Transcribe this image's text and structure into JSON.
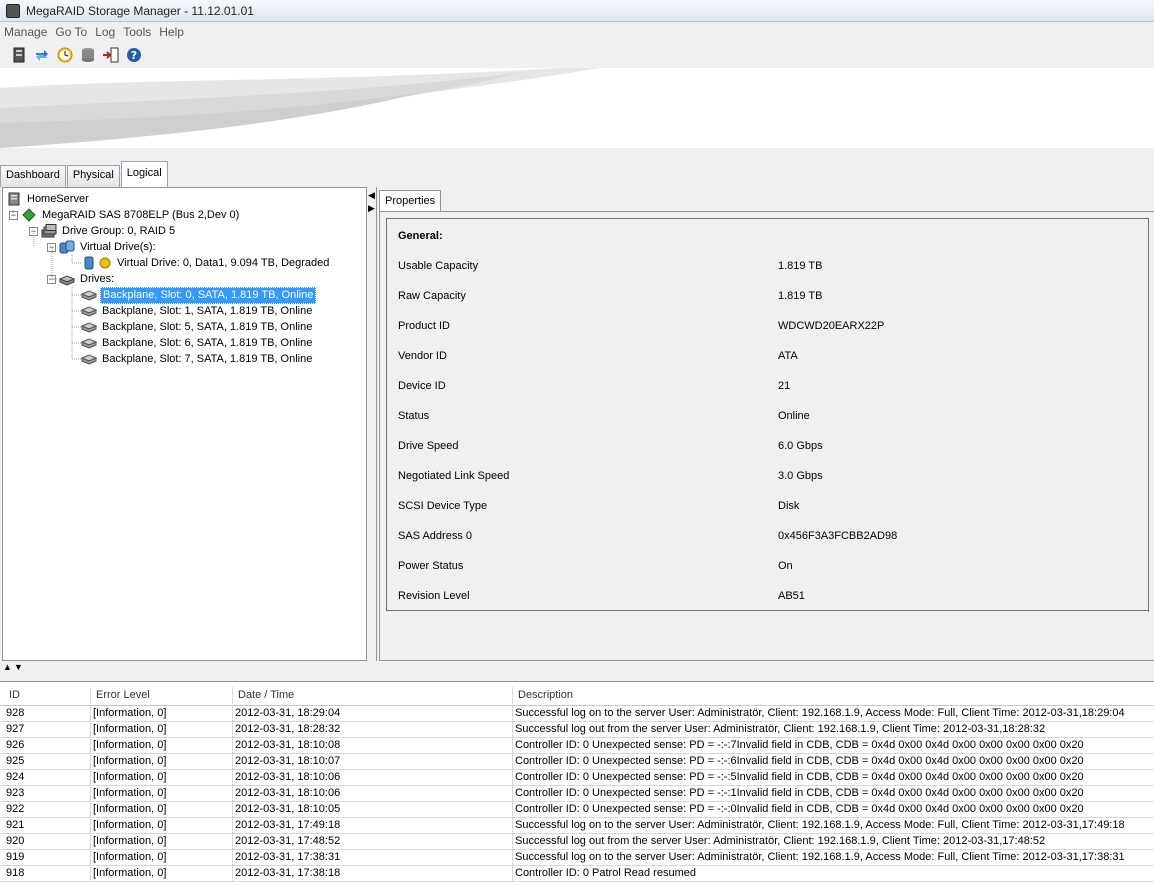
{
  "window": {
    "title": "MegaRAID Storage Manager - 11.12.01.01"
  },
  "menu": [
    "Manage",
    "Go To",
    "Log",
    "Tools",
    "Help"
  ],
  "toolbar": {
    "icons": [
      "server-icon",
      "refresh-icon",
      "clock-icon",
      "database-icon",
      "exit-icon",
      "help-icon"
    ]
  },
  "tabs": {
    "dashboard": "Dashboard",
    "physical": "Physical",
    "logical": "Logical"
  },
  "tree": {
    "root": "HomeServer",
    "controller": "MegaRAID SAS 8708ELP (Bus 2,Dev 0)",
    "drive_group": "Drive Group: 0, RAID  5",
    "virtual_drives_label": "Virtual Drive(s):",
    "virtual_drive": "Virtual Drive: 0, Data1, 9.094 TB, Degraded",
    "drives_label": "Drives:",
    "drives": [
      "Backplane, Slot: 0, SATA, 1.819 TB, Online",
      "Backplane, Slot: 1, SATA, 1.819 TB, Online",
      "Backplane, Slot: 5, SATA, 1.819 TB, Online",
      "Backplane, Slot: 6, SATA, 1.819 TB, Online",
      "Backplane, Slot: 7, SATA, 1.819 TB, Online"
    ]
  },
  "properties": {
    "tab_label": "Properties",
    "section": "General:",
    "rows": [
      {
        "key": "Usable Capacity",
        "value": "1.819 TB"
      },
      {
        "key": "Raw Capacity",
        "value": "1.819 TB"
      },
      {
        "key": "Product ID",
        "value": "WDCWD20EARX22P"
      },
      {
        "key": "Vendor ID",
        "value": "ATA"
      },
      {
        "key": "Device ID",
        "value": "21"
      },
      {
        "key": "Status",
        "value": "Online"
      },
      {
        "key": "Drive Speed",
        "value": "6.0 Gbps"
      },
      {
        "key": "Negotiated Link Speed",
        "value": "3.0 Gbps"
      },
      {
        "key": "SCSI Device Type",
        "value": "Disk"
      },
      {
        "key": "SAS Address 0",
        "value": "0x456F3A3FCBB2AD98"
      },
      {
        "key": "Power Status",
        "value": "On"
      },
      {
        "key": "Revision Level",
        "value": "AB51"
      }
    ]
  },
  "log": {
    "headers": {
      "id": "ID",
      "level": "Error Level",
      "datetime": "Date / Time",
      "description": "Description"
    },
    "rows": [
      {
        "id": "928",
        "level": "[Information, 0]",
        "datetime": "2012-03-31, 18:29:04",
        "description": "Successful log on to the server User:  Administratör, Client:  192.168.1.9,    Access Mode:  Full, Client Time:  2012-03-31,18:29:04"
      },
      {
        "id": "927",
        "level": "[Information, 0]",
        "datetime": "2012-03-31, 18:28:32",
        "description": "Successful log out from the server User:  Administratör, Client:  192.168.1.9,    Client Time:  2012-03-31,18:28:32"
      },
      {
        "id": "926",
        "level": "[Information, 0]",
        "datetime": "2012-03-31, 18:10:08",
        "description": "Controller ID:  0   Unexpected sense:   PD     =   -:-:7Invalid field in CDB,   CDB    =    0x4d 0x00 0x4d 0x00 0x00 0x00 0x00 0x20"
      },
      {
        "id": "925",
        "level": "[Information, 0]",
        "datetime": "2012-03-31, 18:10:07",
        "description": "Controller ID:  0   Unexpected sense:   PD     =   -:-:6Invalid field in CDB,   CDB    =    0x4d 0x00 0x4d 0x00 0x00 0x00 0x00 0x20"
      },
      {
        "id": "924",
        "level": "[Information, 0]",
        "datetime": "2012-03-31, 18:10:06",
        "description": "Controller ID:  0   Unexpected sense:   PD     =   -:-:5Invalid field in CDB,   CDB    =    0x4d 0x00 0x4d 0x00 0x00 0x00 0x00 0x20"
      },
      {
        "id": "923",
        "level": "[Information, 0]",
        "datetime": "2012-03-31, 18:10:06",
        "description": "Controller ID:  0   Unexpected sense:   PD     =   -:-:1Invalid field in CDB,   CDB    =    0x4d 0x00 0x4d 0x00 0x00 0x00 0x00 0x20"
      },
      {
        "id": "922",
        "level": "[Information, 0]",
        "datetime": "2012-03-31, 18:10:05",
        "description": "Controller ID:  0   Unexpected sense:   PD     =   -:-:0Invalid field in CDB,   CDB    =    0x4d 0x00 0x4d 0x00 0x00 0x00 0x00 0x20"
      },
      {
        "id": "921",
        "level": "[Information, 0]",
        "datetime": "2012-03-31, 17:49:18",
        "description": "Successful log on to the server User:  Administratör, Client:  192.168.1.9,    Access Mode:  Full, Client Time:  2012-03-31,17:49:18"
      },
      {
        "id": "920",
        "level": "[Information, 0]",
        "datetime": "2012-03-31, 17:48:52",
        "description": "Successful log out from the server User:  Administratör, Client:  192.168.1.9,    Client Time:  2012-03-31,17:48:52"
      },
      {
        "id": "919",
        "level": "[Information, 0]",
        "datetime": "2012-03-31, 17:38:31",
        "description": "Successful log on to the server User:  Administratör, Client:  192.168.1.9,    Access Mode:  Full, Client Time:  2012-03-31,17:38:31"
      },
      {
        "id": "918",
        "level": "[Information, 0]",
        "datetime": "2012-03-31, 17:38:18",
        "description": "Controller ID:  0   Patrol Read resumed"
      }
    ]
  },
  "colors": {
    "selection": "#3399ff",
    "accent_blue": "#1f5fa8"
  }
}
